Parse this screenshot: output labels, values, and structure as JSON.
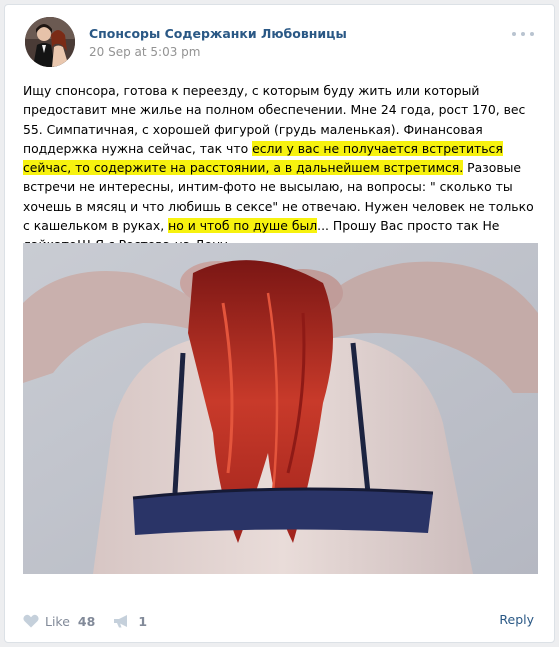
{
  "post": {
    "author": "Спонсоры Содержанки Любовницы",
    "date": "20 Sep at 5:03 pm",
    "text_segments": [
      "Ищу спонсора, готова к переезду, с которым буду жить или который предоставит мне жилье на полном обеспечении. Мне 24 года, рост 170, вес 55. Симпатичная, с хорошей фигурой (грудь маленькая). Финансовая поддержка нужна сейчас, так что ",
      "если у вас не получается встретиться сейчас, то содержите на расстоянии, а в дальнейшем встретимся.",
      " Разовые встречи не интересны, интим-фото не высылаю, на вопросы: \" сколько ты хочешь в мясяц и что любишь в сексе\" не отвечаю. Нужен человек не только с кашельком в руках, ",
      "но и чтоб по душе был",
      "... Прошу Вас просто так Не лайкате!!! Я с Ростова-на-Дону"
    ],
    "highlight_color": "#f7f20f"
  },
  "actions": {
    "like_label": "Like",
    "like_count": "48",
    "share_count": "1",
    "reply_label": "Reply"
  },
  "icons": {
    "like": "heart-icon",
    "share": "megaphone-icon",
    "more": "more-dots-icon"
  },
  "colors": {
    "link": "#2a5885",
    "muted": "#828a99",
    "date": "#939393",
    "highlight": "#f7f20f"
  }
}
